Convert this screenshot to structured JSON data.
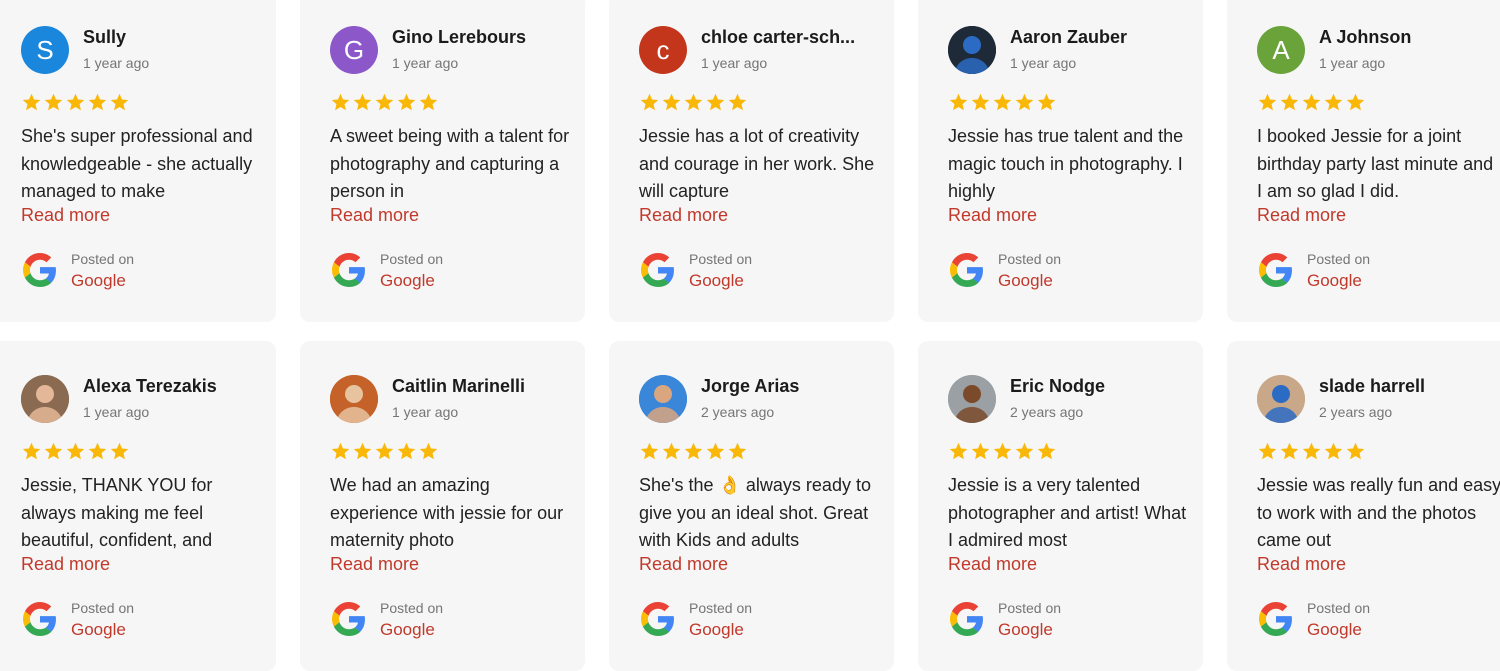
{
  "colors": {
    "card_bg": "#f6f6f6",
    "star": "#f9b807",
    "link": "#c0392b"
  },
  "reviews": [
    {
      "name": "Sully",
      "time": "1 year ago",
      "rating": 5,
      "avatar_letter": "S",
      "avatar_color": "#1a86dc",
      "text": "She's super professional and knowledgeable - she actually managed to make",
      "more": "Read more",
      "posted": "Posted on",
      "source": "Google"
    },
    {
      "name": "Gino Lerebours",
      "time": "1 year ago",
      "rating": 5,
      "avatar_letter": "G",
      "avatar_color": "#8b57c9",
      "text": "A sweet being with a talent for photography and capturing a person in",
      "more": "Read more",
      "posted": "Posted on",
      "source": "Google"
    },
    {
      "name": "chloe carter-sch...",
      "time": "1 year ago",
      "rating": 5,
      "avatar_letter": "c",
      "avatar_color": "#c3361c",
      "text": "Jessie has a lot of creativity and courage in her work. She will capture",
      "more": "Read more",
      "posted": "Posted on",
      "source": "Google"
    },
    {
      "name": "Aaron Zauber",
      "time": "1 year ago",
      "rating": 5,
      "avatar_letter": "",
      "avatar_color": "#1e2a38",
      "text": "Jessie has true talent and the magic touch in photography. I highly",
      "more": "Read more",
      "posted": "Posted on",
      "source": "Google"
    },
    {
      "name": "A Johnson",
      "time": "1 year ago",
      "rating": 5,
      "avatar_letter": "A",
      "avatar_color": "#69a33a",
      "text": "I booked Jessie for a joint birthday party last minute and I am so glad I did.",
      "more": "Read more",
      "posted": "Posted on",
      "source": "Google"
    },
    {
      "name": "Alexa Terezakis",
      "time": "1 year ago",
      "rating": 5,
      "avatar_letter": "",
      "avatar_color": "#8a6b52",
      "text": "Jessie, THANK YOU for always making me feel beautiful, confident, and",
      "more": "Read more",
      "posted": "Posted on",
      "source": "Google"
    },
    {
      "name": "Caitlin Marinelli",
      "time": "1 year ago",
      "rating": 5,
      "avatar_letter": "",
      "avatar_color": "#c4622a",
      "text": "We had an amazing experience with jessie for our maternity photo",
      "more": "Read more",
      "posted": "Posted on",
      "source": "Google"
    },
    {
      "name": "Jorge Arias",
      "time": "2 years ago",
      "rating": 5,
      "avatar_letter": "",
      "avatar_color": "#3a86d8",
      "text": "She's the 👌 always ready to give you an ideal shot. Great with Kids and adults",
      "more": "Read more",
      "posted": "Posted on",
      "source": "Google"
    },
    {
      "name": "Eric Nodge",
      "time": "2 years ago",
      "rating": 5,
      "avatar_letter": "",
      "avatar_color": "#9aa0a3",
      "text": "Jessie is a very talented photographer and artist! What I admired most",
      "more": "Read more",
      "posted": "Posted on",
      "source": "Google"
    },
    {
      "name": "slade harrell",
      "time": "2 years ago",
      "rating": 5,
      "avatar_letter": "",
      "avatar_color": "#c9a88a",
      "text": "Jessie was really fun and easy to work with and the photos came out",
      "more": "Read more",
      "posted": "Posted on",
      "source": "Google"
    }
  ]
}
